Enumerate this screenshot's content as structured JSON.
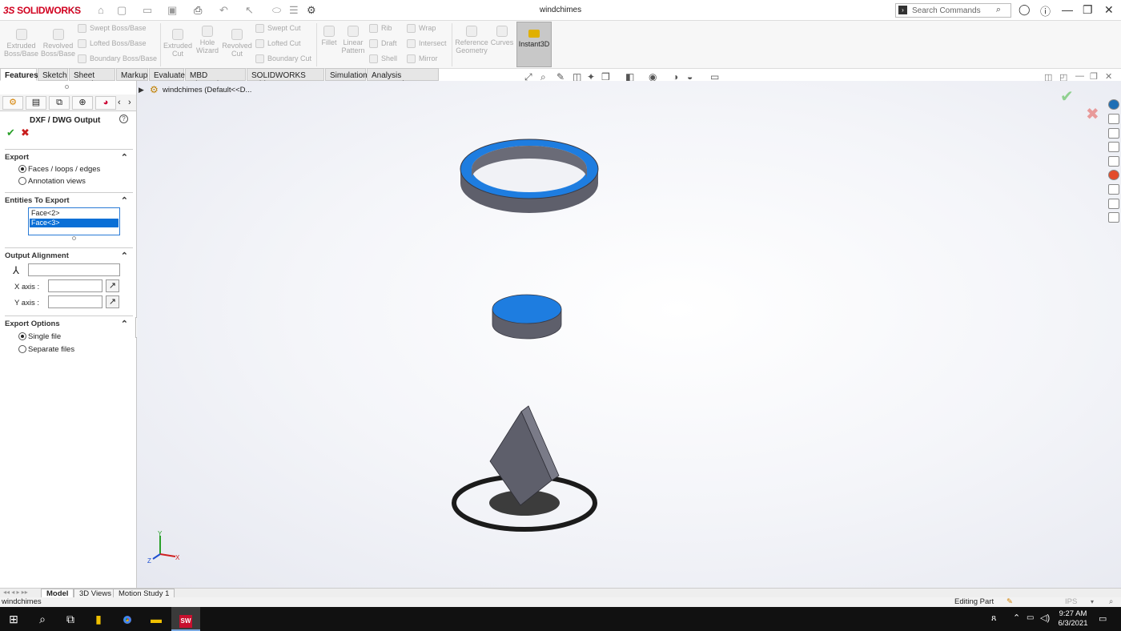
{
  "app": {
    "brand_prefix": "3S",
    "brand_name": "SOLIDWORKS",
    "doc_title": "windchimes",
    "search_placeholder": "Search Commands",
    "search_icon_glyph": "⌕"
  },
  "ribbon": {
    "extruded_boss": "Extruded Boss/Base",
    "revolved_boss": "Revolved Boss/Base",
    "swept_boss": "Swept Boss/Base",
    "lofted_boss": "Lofted Boss/Base",
    "boundary_boss": "Boundary Boss/Base",
    "extruded_cut": "Extruded Cut",
    "hole_wizard": "Hole Wizard",
    "revolved_cut": "Revolved Cut",
    "swept_cut": "Swept Cut",
    "lofted_cut": "Lofted Cut",
    "boundary_cut": "Boundary Cut",
    "fillet": "Fillet",
    "linear_pattern": "Linear Pattern",
    "rib": "Rib",
    "draft": "Draft",
    "shell": "Shell",
    "wrap": "Wrap",
    "intersect": "Intersect",
    "mirror": "Mirror",
    "reference_geometry": "Reference Geometry",
    "curves": "Curves",
    "instant3d": "Instant3D"
  },
  "tabs": [
    "Features",
    "Sketch",
    "Sheet Metal",
    "Markup",
    "Evaluate",
    "MBD Dimensions",
    "SOLIDWORKS Add-Ins",
    "Simulation",
    "Analysis Preparation"
  ],
  "tree": {
    "root_label": "windchimes  (Default<<D..."
  },
  "property_manager": {
    "title": "DXF / DWG Output",
    "help_glyph": "?",
    "ok_glyph": "✔",
    "cancel_glyph": "✖",
    "export": {
      "header": "Export",
      "option1": "Faces / loops / edges",
      "option2": "Annotation views",
      "selected": "Faces / loops / edges"
    },
    "entities": {
      "header": "Entities To Export",
      "items": [
        "Face<2>",
        "Face<3>"
      ],
      "selected": "Face<3>"
    },
    "alignment": {
      "header": "Output Alignment",
      "x_label": "X axis :",
      "y_label": "Y axis :"
    },
    "export_options": {
      "header": "Export Options",
      "option1": "Single file",
      "option2": "Separate files",
      "selected": "Single file"
    }
  },
  "triad": {
    "x": "X",
    "y": "Y",
    "z": "Z"
  },
  "bottom_tabs": [
    "Model",
    "3D Views",
    "Motion Study 1"
  ],
  "status": {
    "left": "windchimes",
    "mode": "Editing Part",
    "units": "IPS"
  },
  "clock": {
    "time": "9:27 AM",
    "date": "6/3/2021"
  },
  "colors": {
    "accent": "#0a6fd6",
    "face_blue": "#1e7de0",
    "body_gray": "#5e5f6b",
    "brand_red": "#d1001f"
  }
}
